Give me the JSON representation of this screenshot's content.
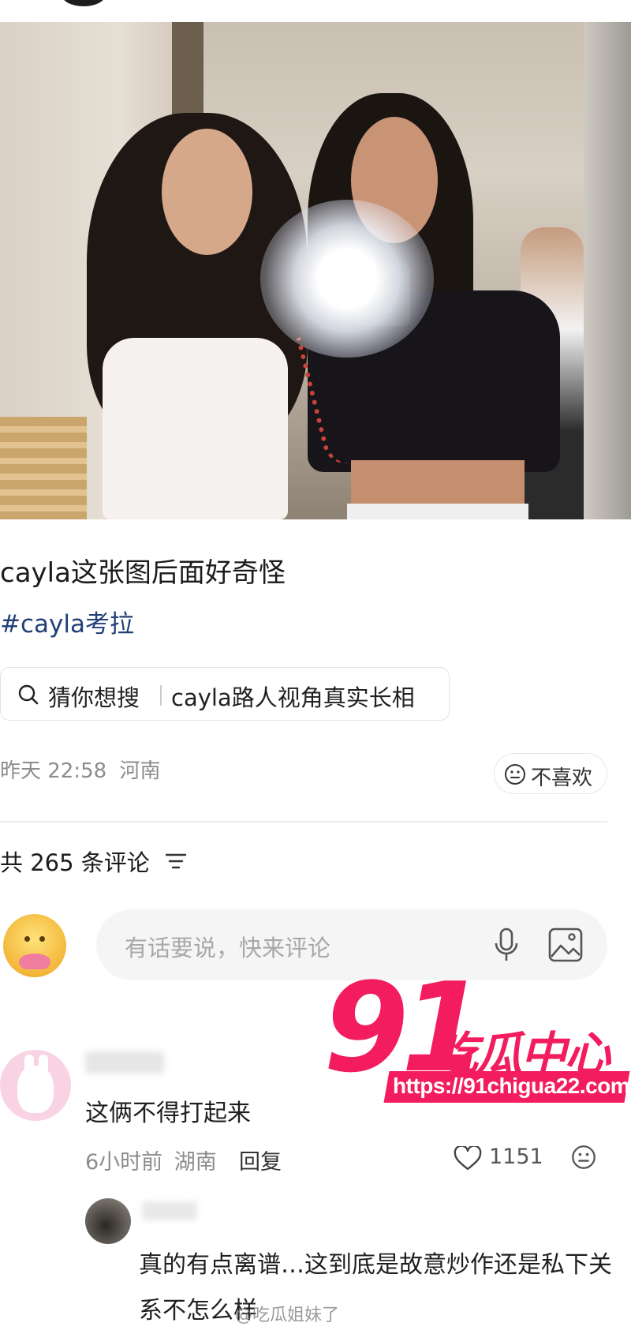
{
  "post": {
    "title": "cayla这张图后面好奇怪",
    "hashtag": "#cayla考拉",
    "time": "昨天 22:58",
    "location": "河南",
    "dislike_label": "不喜欢"
  },
  "guess_search": {
    "label": "猜你想搜",
    "term": "cayla路人视角真实长相"
  },
  "comments_header": {
    "count_text": "共 265 条评论"
  },
  "comment_input": {
    "placeholder": "有话要说，快来评论"
  },
  "comments": [
    {
      "text": "这俩不得打起来",
      "time": "6小时前",
      "location": "湖南",
      "reply_label": "回复",
      "likes": "1151"
    },
    {
      "text": "真的有点离谱…这到底是故意炒作还是私下关系不怎么样"
    }
  ],
  "watermarks": {
    "brand_number": "91",
    "brand_text": "吃瓜中心",
    "brand_url": "https://91chigua22.com",
    "weibo_mark": "@吃瓜姐妹了"
  },
  "colors": {
    "brand": "#f21c5f",
    "hashtag": "#1f3f77",
    "meta": "#8c8c8c"
  }
}
